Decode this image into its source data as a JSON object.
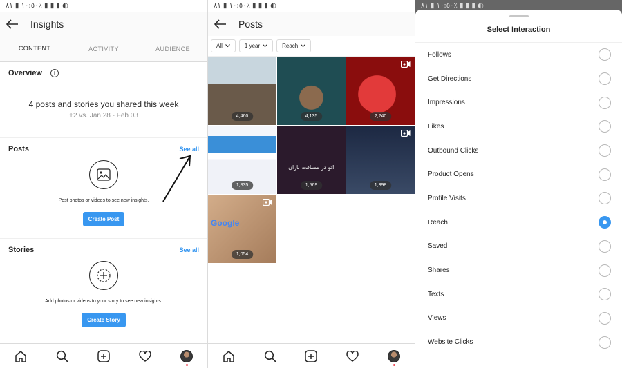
{
  "status": {
    "text": "١٠:٥٠ ▮ ٨١٪ ▮ ▮ ▮ ◐"
  },
  "insights": {
    "title": "Insights",
    "tabs": [
      "CONTENT",
      "ACTIVITY",
      "AUDIENCE"
    ],
    "overview": {
      "title": "Overview",
      "main": "4 posts and stories you shared this week",
      "sub": "+2 vs. Jan 28 - Feb 03"
    },
    "posts": {
      "title": "Posts",
      "see_all": "See all",
      "hint": "Post photos or videos to see new insights.",
      "button": "Create Post"
    },
    "stories": {
      "title": "Stories",
      "see_all": "See all",
      "hint": "Add photos or videos to your story to see new insights.",
      "button": "Create Story"
    }
  },
  "posts_screen": {
    "title": "Posts",
    "filters": [
      "All",
      "1 year",
      "Reach"
    ],
    "items": [
      {
        "count": "4,460",
        "video": false,
        "color": "#8aa3b5"
      },
      {
        "count": "4,135",
        "video": false,
        "color": "#2f6b6e"
      },
      {
        "count": "2,240",
        "video": true,
        "color": "#b01d1d"
      },
      {
        "count": "1,835",
        "video": false,
        "color": "#e8ecf5"
      },
      {
        "count": "1,569",
        "video": false,
        "color": "#2b1a2c",
        "overlay_text": "تو در مسافت باران!"
      },
      {
        "count": "1,398",
        "video": true,
        "color": "#2a3a55"
      },
      {
        "count": "1,054",
        "video": true,
        "color": "#c39a78",
        "overlay_text": "Google"
      }
    ]
  },
  "interaction": {
    "title": "Select Interaction",
    "options": [
      "Follows",
      "Get Directions",
      "Impressions",
      "Likes",
      "Outbound Clicks",
      "Product Opens",
      "Profile Visits",
      "Reach",
      "Saved",
      "Shares",
      "Texts",
      "Views",
      "Website Clicks"
    ],
    "selected": "Reach"
  },
  "colors": {
    "accent": "#3897f0",
    "notification": "#ed4956"
  }
}
